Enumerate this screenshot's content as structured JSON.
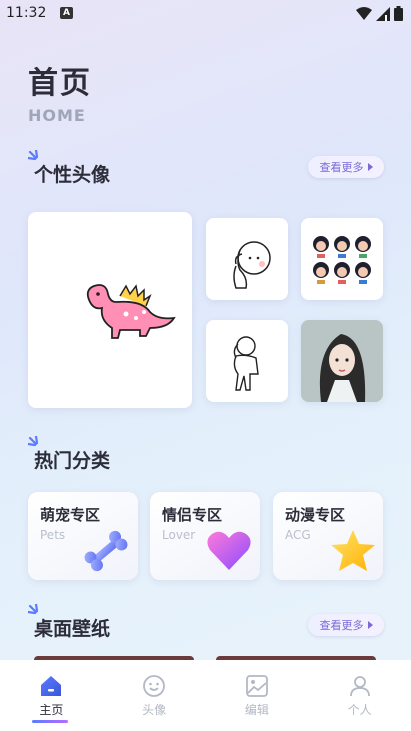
{
  "status": {
    "time": "11:32",
    "notif_glyph": "A"
  },
  "header": {
    "title": "首页",
    "subtitle": "HOME"
  },
  "sections": {
    "avatars": {
      "title": "个性头像",
      "more": "查看更多"
    },
    "hot": {
      "title": "热门分类"
    },
    "wallpaper": {
      "title": "桌面壁纸",
      "more": "查看更多"
    }
  },
  "categories": [
    {
      "title": "萌宠专区",
      "sub": "Pets",
      "icon": "bone-icon",
      "color": "#7b8cff"
    },
    {
      "title": "情侣专区",
      "sub": "Lover",
      "icon": "heart-icon",
      "color": "#c46bff"
    },
    {
      "title": "动漫专区",
      "sub": "ACG",
      "icon": "star-icon",
      "color": "#ffc21a"
    }
  ],
  "tabs": [
    {
      "label": "主页",
      "icon": "home-icon",
      "active": true
    },
    {
      "label": "头像",
      "icon": "face-icon",
      "active": false
    },
    {
      "label": "编辑",
      "icon": "image-edit-icon",
      "active": false
    },
    {
      "label": "个人",
      "icon": "person-icon",
      "active": false
    }
  ],
  "colors": {
    "accent": "#7a6ad8",
    "sparkle": "#5a7cff",
    "text": "#2d2d3a",
    "muted": "#b3b8c4"
  }
}
